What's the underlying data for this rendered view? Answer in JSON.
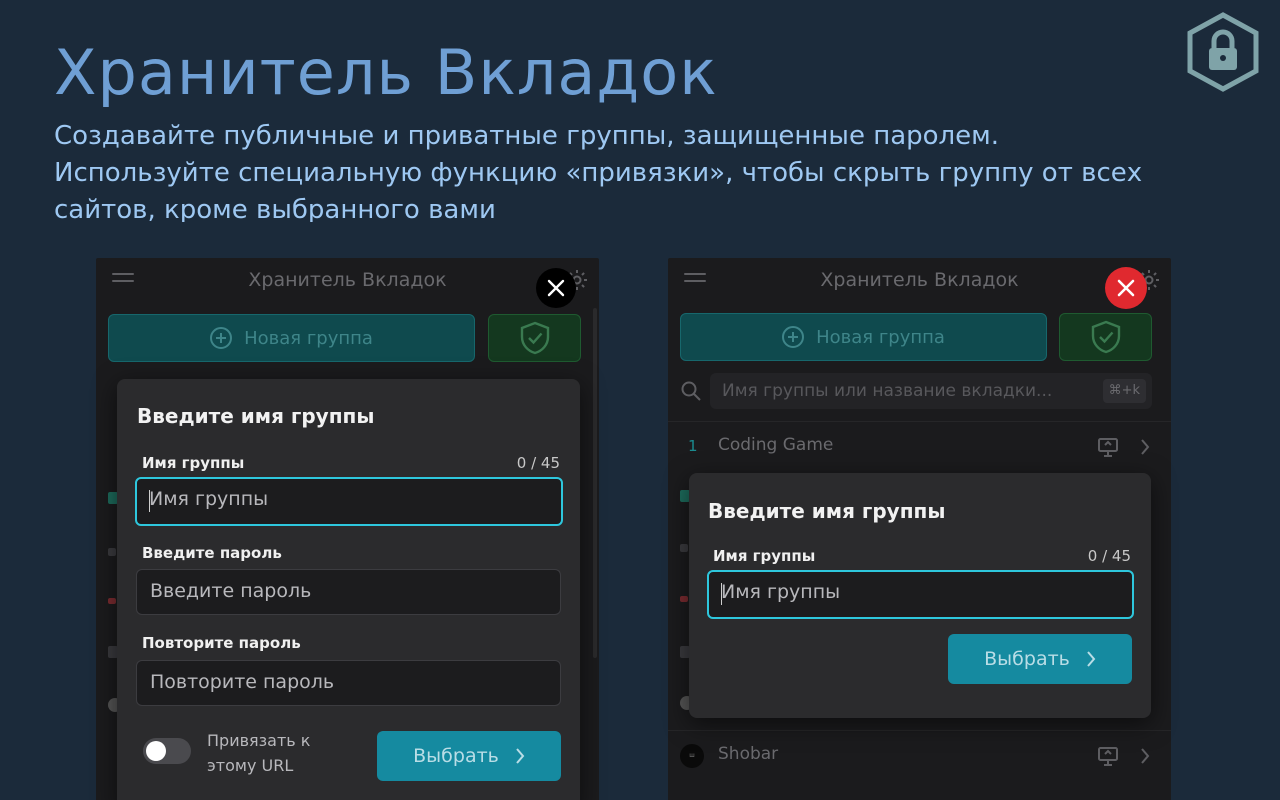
{
  "hero": {
    "title": "Хранитель Вкладок",
    "description": "Создавайте публичные и приватные группы, защищенные паролем. Используйте специальную функцию «привязки», чтобы скрыть группу от всех сайтов, кроме выбранного вами"
  },
  "colors": {
    "background": "#1b2a3a",
    "title": "#6f9fd4",
    "accent_teal": "#158aa0",
    "focus_border": "#2ec7dd",
    "close_red": "#e0292f"
  },
  "icons": [
    "lock-shield-icon",
    "menu-icon",
    "gear-icon",
    "plus-circle-icon",
    "shield-check-icon",
    "search-icon",
    "close-icon",
    "chevron-right-icon",
    "monitor-icon"
  ],
  "left_panel": {
    "app_title": "Хранитель Вкладок",
    "new_group_label": "Новая группа",
    "modal": {
      "title": "Введите имя группы",
      "name_label": "Имя группы",
      "name_counter": "0 / 45",
      "name_placeholder": "Имя группы",
      "password_label": "Введите пароль",
      "password_placeholder": "Введите пароль",
      "repeat_label": "Повторите пароль",
      "repeat_placeholder": "Повторите пароль",
      "bind_label": "Привязать к этому URL",
      "bind_enabled": false,
      "choose_label": "Выбрать"
    }
  },
  "right_panel": {
    "app_title": "Хранитель Вкладок",
    "new_group_label": "Новая группа",
    "search_placeholder": "Имя группы или название вкладки...",
    "search_shortcut": "⌘+k",
    "rows": [
      {
        "num": "1",
        "label": "Coding Game"
      },
      {
        "num": "",
        "label": "Shobar"
      }
    ],
    "modal": {
      "title": "Введите имя группы",
      "name_label": "Имя группы",
      "name_counter": "0 / 45",
      "name_placeholder": "Имя группы",
      "choose_label": "Выбрать"
    }
  }
}
